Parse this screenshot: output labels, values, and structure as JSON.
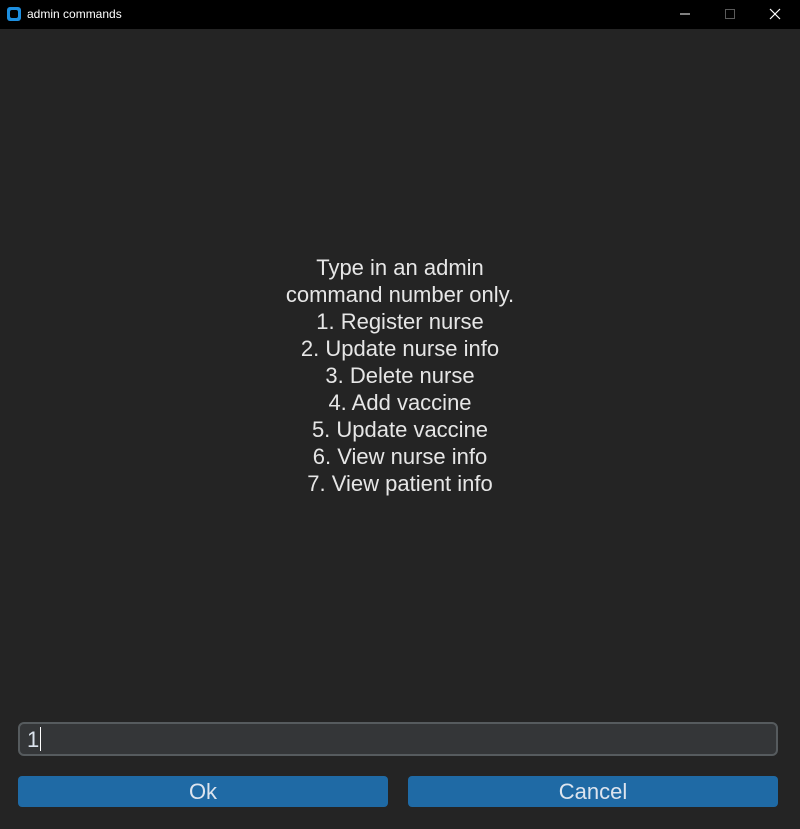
{
  "window": {
    "title": "admin commands",
    "icon": "app-icon"
  },
  "prompt": {
    "lines": [
      "Type in an admin",
      "command number only.",
      "1. Register nurse",
      "2. Update nurse info",
      "3. Delete nurse",
      "4. Add vaccine",
      "5. Update vaccine",
      "6. View nurse info",
      "7. View patient info"
    ]
  },
  "entry": {
    "value": "1"
  },
  "buttons": {
    "ok_label": "Ok",
    "cancel_label": "Cancel"
  },
  "colors": {
    "accent": "#1f6aa5",
    "background": "#242424",
    "titlebar": "#000000"
  }
}
